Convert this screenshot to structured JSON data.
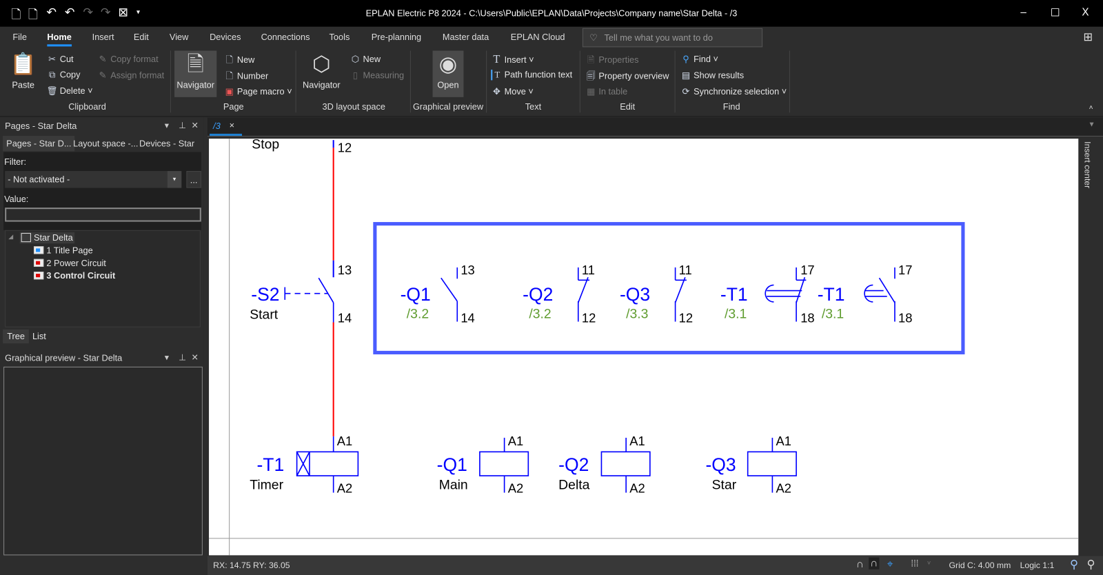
{
  "window": {
    "title": "EPLAN Electric P8 2024 - C:\\Users\\Public\\EPLAN\\Data\\Projects\\Company name\\Star Delta - /3",
    "minimize": "–",
    "maximize": "☐",
    "close": "X"
  },
  "quick_access": [
    "new-page-icon",
    "open-icon",
    "undo-all-icon",
    "undo-icon",
    "redo-icon",
    "redo-all-icon",
    "properties-filter-icon",
    "customize-icon"
  ],
  "menu": {
    "items": [
      "File",
      "Home",
      "Insert",
      "Edit",
      "View",
      "Devices",
      "Connections",
      "Tools",
      "Pre-planning",
      "Master data",
      "EPLAN Cloud"
    ],
    "active": "Home",
    "search_placeholder": "Tell me what you want to do"
  },
  "ribbon": {
    "clipboard": {
      "paste": "Paste",
      "cut": "Cut",
      "copy": "Copy",
      "delete": "Delete",
      "copy_format": "Copy format",
      "assign_format": "Assign format",
      "group": "Clipboard"
    },
    "page": {
      "navigator": "Navigator",
      "new": "New",
      "number": "Number",
      "page_macro": "Page macro",
      "group": "Page"
    },
    "layout3d": {
      "navigator": "Navigator",
      "new": "New",
      "measuring": "Measuring",
      "group": "3D layout space"
    },
    "preview": {
      "open": "Open",
      "group": "Graphical preview"
    },
    "text": {
      "insert": "Insert",
      "path_function_text": "Path function text",
      "move": "Move",
      "group": "Text"
    },
    "edit": {
      "properties": "Properties",
      "property_overview": "Property overview",
      "in_table": "In table",
      "group": "Edit"
    },
    "find": {
      "find": "Find",
      "show_results": "Show results",
      "synchronize": "Synchronize selection",
      "group": "Find"
    }
  },
  "pages_panel": {
    "title": "Pages - Star Delta",
    "tabs": [
      "Pages - Star D...",
      "Layout space -...",
      "Devices - Star ..."
    ],
    "filter_label": "Filter:",
    "filter_value": "- Not activated -",
    "more_button": "...",
    "value_label": "Value:",
    "value": "",
    "tree": {
      "root": "Star Delta",
      "pages": [
        "1 Title Page",
        "2 Power Circuit",
        "3 Control Circuit"
      ],
      "selected": "3 Control Circuit"
    },
    "bottom_tabs": [
      "Tree",
      "List"
    ]
  },
  "preview_panel": {
    "title": "Graphical preview - Star Delta"
  },
  "doc_tab": {
    "label": "/3",
    "close": "×"
  },
  "insert_center": "Insert center",
  "schematic": {
    "stop_label": "Stop",
    "stop_terminal": "12",
    "s2": {
      "tag": "-S2",
      "label": "Start",
      "t1": "13",
      "t2": "14"
    },
    "contacts": [
      {
        "tag": "-Q1",
        "ref": "/3.2",
        "t1": "13",
        "t2": "14"
      },
      {
        "tag": "-Q2",
        "ref": "/3.2",
        "t1": "11",
        "t2": "12"
      },
      {
        "tag": "-Q3",
        "ref": "/3.3",
        "t1": "11",
        "t2": "12"
      },
      {
        "tag": "-T1",
        "ref": "/3.1",
        "t1": "17",
        "t2": "18"
      },
      {
        "tag": "-T1",
        "ref": "/3.1",
        "t1": "17",
        "t2": "18"
      }
    ],
    "coils": [
      {
        "tag": "-T1",
        "label": "Timer",
        "a1": "A1",
        "a2": "A2"
      },
      {
        "tag": "-Q1",
        "label": "Main",
        "a1": "A1",
        "a2": "A2"
      },
      {
        "tag": "-Q2",
        "label": "Delta",
        "a1": "A1",
        "a2": "A2"
      },
      {
        "tag": "-Q3",
        "label": "Star",
        "a1": "A1",
        "a2": "A2"
      }
    ]
  },
  "status": {
    "coords": "RX: 14.75 RY: 36.05",
    "grid": "Grid C: 4.00 mm",
    "logic": "Logic 1:1"
  },
  "colors": {
    "accent": "#1e90ff",
    "device": "#0000ff",
    "wire": "#ff0000",
    "ref": "#5f9c2f",
    "box": "#4a5cff"
  }
}
